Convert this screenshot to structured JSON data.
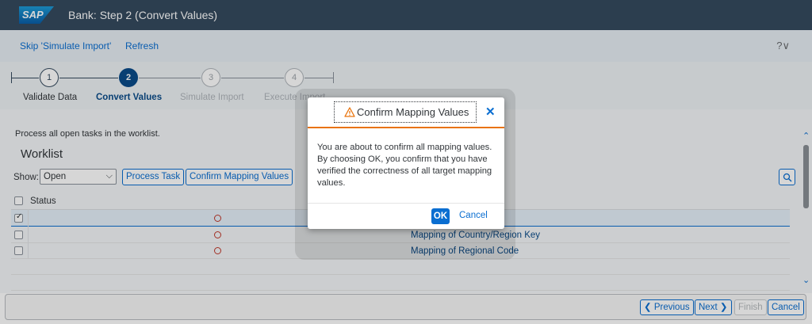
{
  "shell": {
    "logo": "SAP",
    "title": "Bank: Step 2  (Convert Values)"
  },
  "toolbar": {
    "skip_label": "Skip 'Simulate Import'",
    "refresh_label": "Refresh",
    "help": "?∨"
  },
  "wizard": {
    "steps": [
      {
        "number": "1",
        "label": "Validate Data",
        "state": "done"
      },
      {
        "number": "2",
        "label": "Convert Values",
        "state": "current"
      },
      {
        "number": "3",
        "label": "Simulate Import",
        "state": "future"
      },
      {
        "number": "4",
        "label": "Execute Import",
        "state": "future"
      }
    ]
  },
  "worklist": {
    "instruction": "Process all open tasks in the worklist.",
    "title": "Worklist",
    "show_label": "Show:",
    "show_value": "Open",
    "process_task_label": "Process Task",
    "confirm_mapping_label": "Confirm Mapping Values",
    "status_header": "Status",
    "rows": [
      {
        "checked": true,
        "task": ""
      },
      {
        "checked": false,
        "task": "Mapping of Country/Region Key"
      },
      {
        "checked": false,
        "task": "Mapping of Regional Code"
      }
    ]
  },
  "footer": {
    "previous": "Previous",
    "next": "Next",
    "finish": "Finish",
    "cancel": "Cancel"
  },
  "dialog": {
    "title": "Confirm Mapping Values",
    "message": "You are about to confirm all mapping values. By choosing OK, you confirm that you have verified the correctness of all target mapping values.",
    "ok": "OK",
    "cancel": "Cancel"
  },
  "colors": {
    "shell": "#354a5f",
    "accent": "#0a6ed1",
    "warning": "#e9730c",
    "status_error": "#c0392b"
  }
}
